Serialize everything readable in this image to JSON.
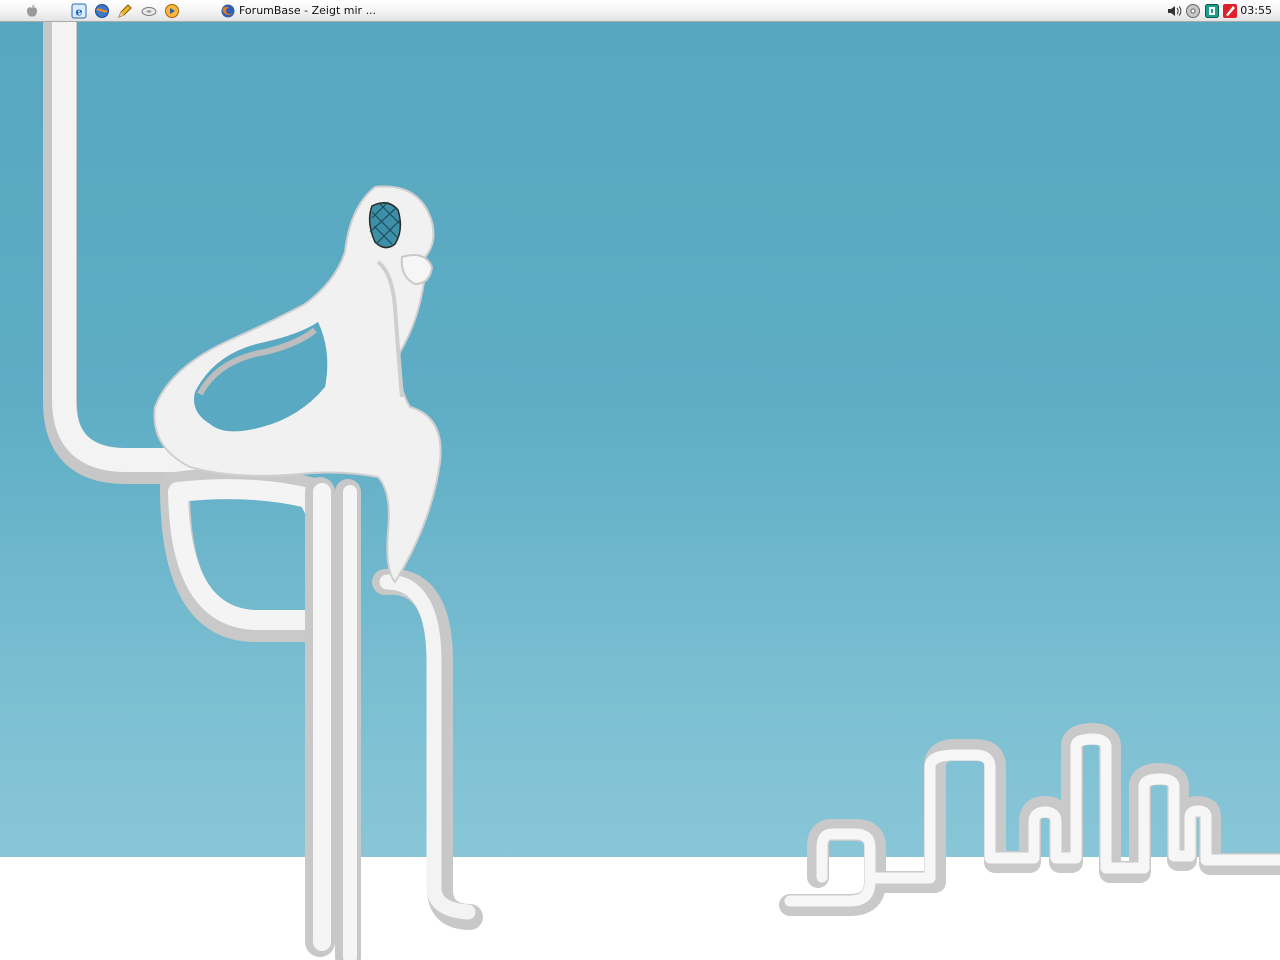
{
  "taskbar": {
    "launchers": [
      {
        "icon": "apple-icon"
      },
      {
        "icon": "internet-explorer-icon"
      },
      {
        "icon": "browser-globe-icon"
      },
      {
        "icon": "pencil-icon"
      },
      {
        "icon": "drive-icon"
      },
      {
        "icon": "media-player-icon"
      }
    ],
    "active_task": {
      "icon": "firefox-icon",
      "label": "ForumBase - Zeigt mir ..."
    },
    "tray": [
      {
        "icon": "volume-icon"
      },
      {
        "icon": "disc-icon"
      },
      {
        "icon": "antivirus-icon"
      },
      {
        "icon": "red-app-icon"
      }
    ],
    "clock": "03:55"
  },
  "desktop": {
    "wallpaper": "thinker-ribbon",
    "colors": {
      "sky_top": "#56a7c0",
      "sky_bottom": "#90cbdb",
      "floor": "#ffffff",
      "figure": "#f2f2f2",
      "figure_shade": "#c9c9c9"
    }
  }
}
